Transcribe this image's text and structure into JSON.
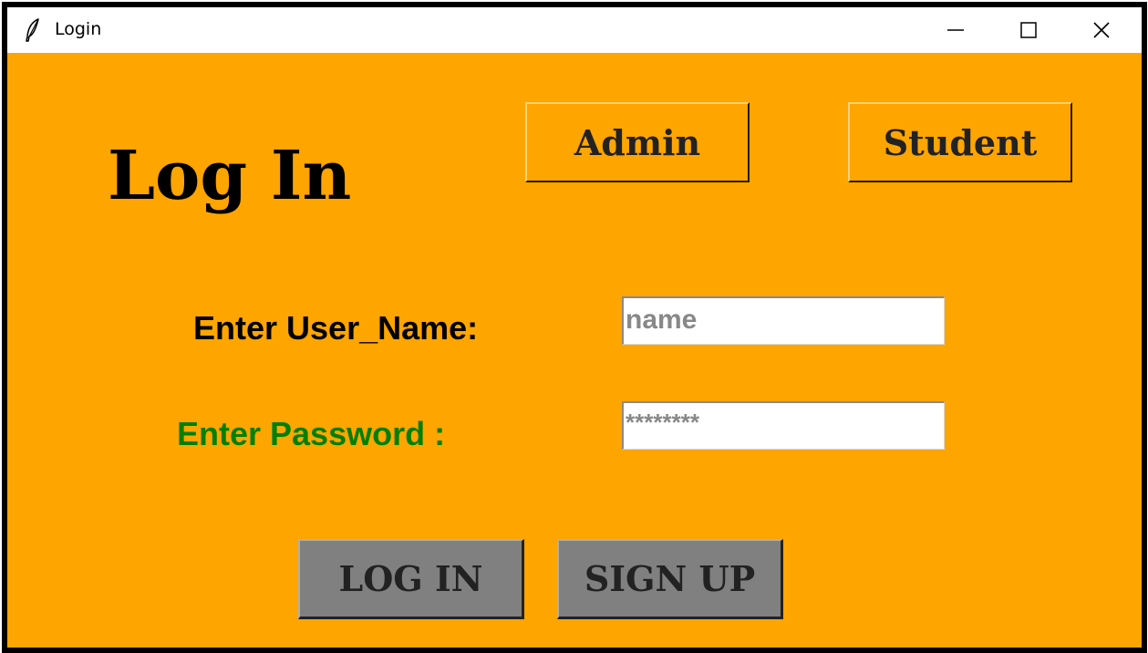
{
  "window": {
    "title": "Login",
    "icon": "feather-icon",
    "controls": {
      "minimize_icon": "minimize-icon",
      "maximize_icon": "maximize-icon",
      "close_icon": "close-icon"
    }
  },
  "colors": {
    "background": "#ffa500",
    "heading": "#000000",
    "username_label": "#000000",
    "password_label": "#008000",
    "entry_text": "#888888",
    "action_button_bg": "#808080"
  },
  "heading": "Log In",
  "role_buttons": {
    "admin_label": "Admin",
    "student_label": "Student"
  },
  "form": {
    "username_label": "Enter User_Name:",
    "username_value": "name",
    "password_label": "Enter Password :",
    "password_value": "********"
  },
  "actions": {
    "login_label": "LOG IN",
    "signup_label": "SIGN UP"
  }
}
